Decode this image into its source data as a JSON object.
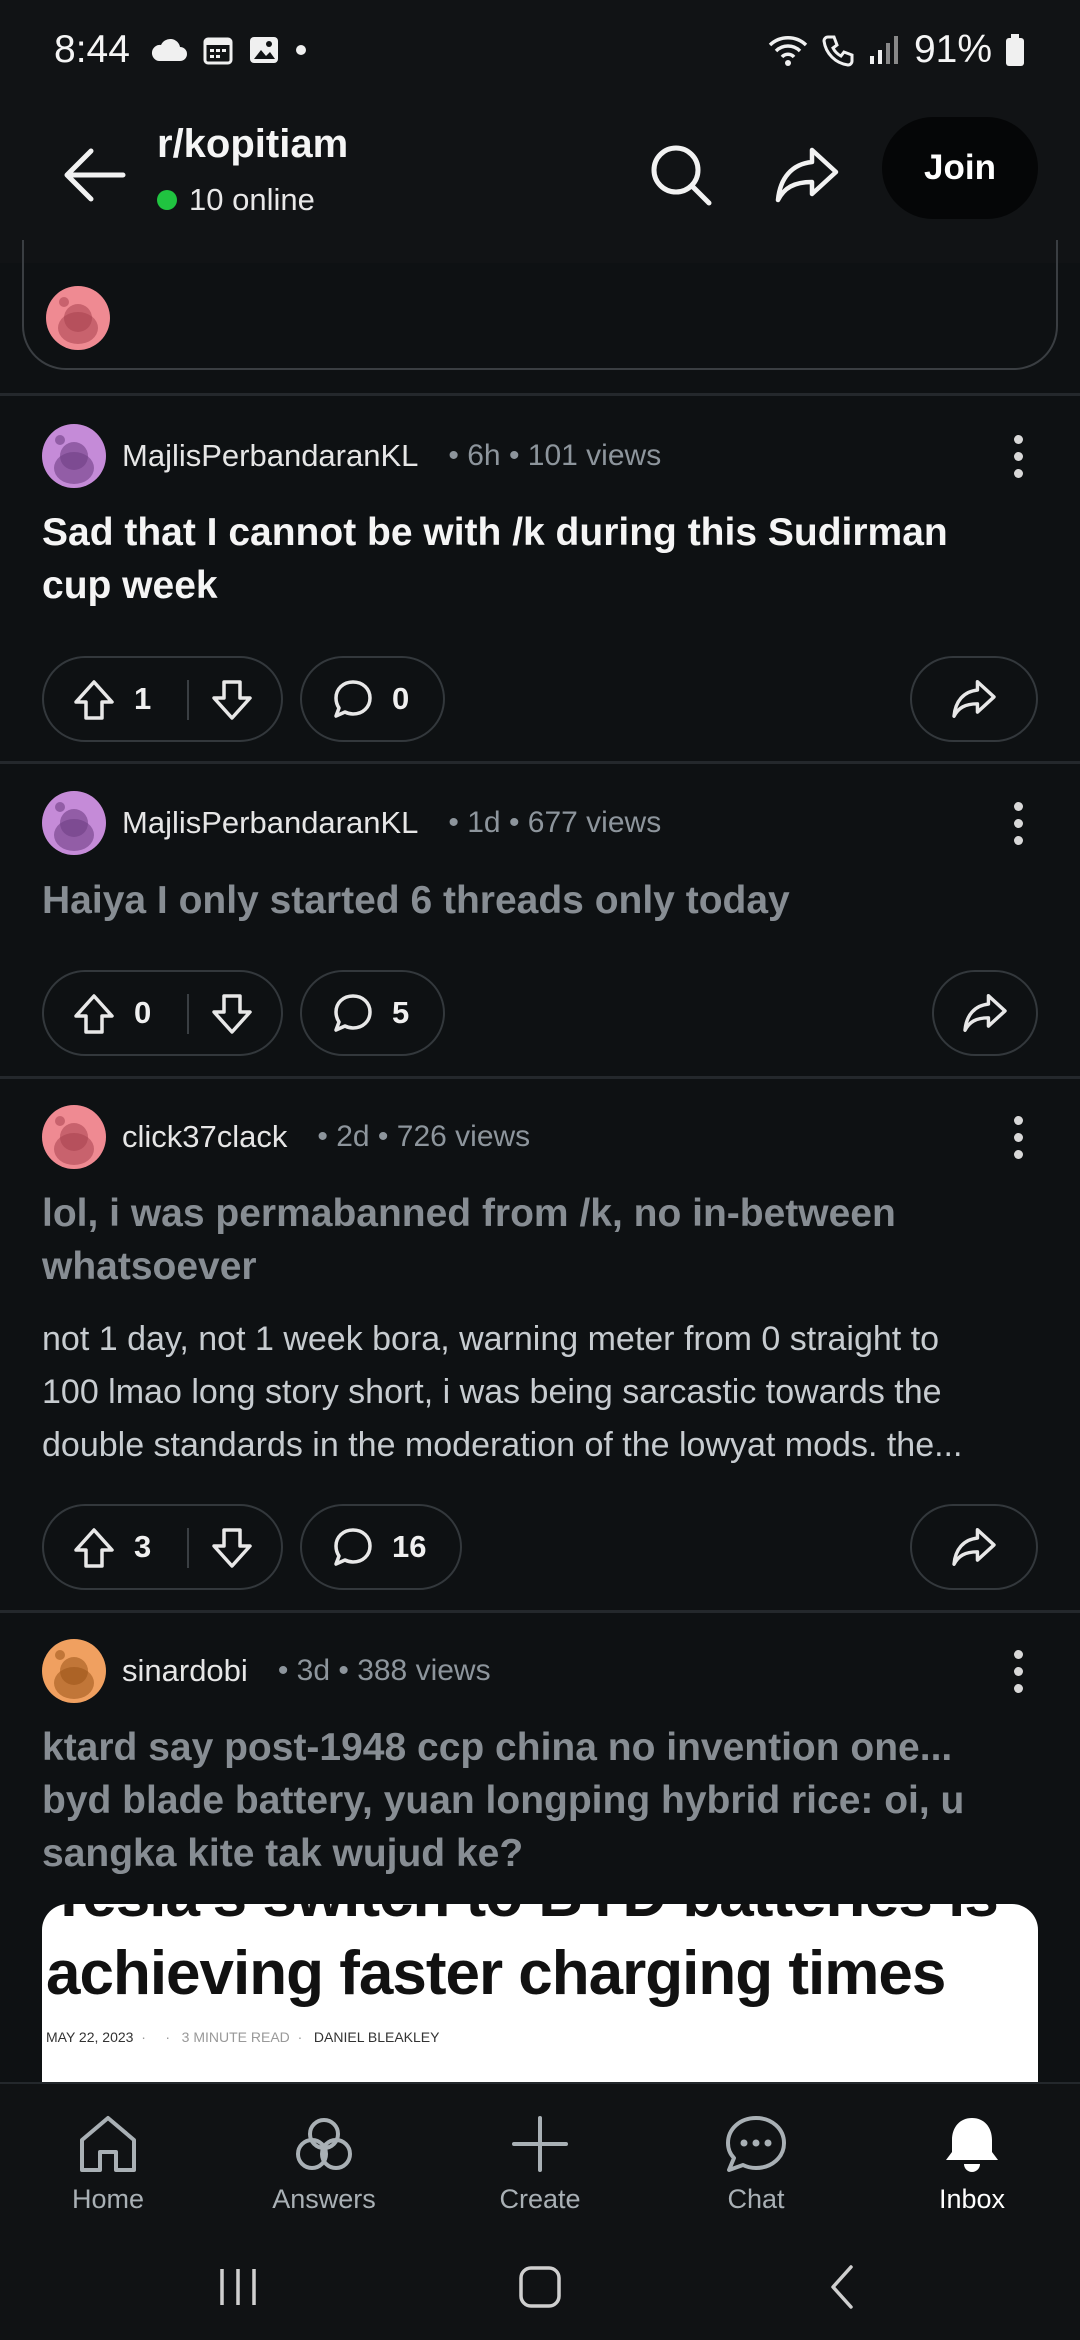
{
  "status_bar": {
    "time": "8:44",
    "battery": "91%"
  },
  "header": {
    "subreddit": "r/kopitiam",
    "online": "10 online",
    "join_label": "Join",
    "colors": {
      "online_dot": "#20c440"
    }
  },
  "posts": [
    {
      "username": "MajlisPerbandaranKL",
      "meta": "• 6h • 101 views",
      "title_line1": "Sad that I cannot be with /k during this Sudirman",
      "title_line2": "cup week",
      "upvotes": "1",
      "comments": "0",
      "avatar_color": "#c58bd8",
      "read": false
    },
    {
      "username": "MajlisPerbandaranKL",
      "meta": "• 1d • 677 views",
      "title_line1": "Haiya I only started 6 threads only today",
      "upvotes": "0",
      "comments": "5",
      "avatar_color": "#c58bd8",
      "read": true
    },
    {
      "username": "click37clack",
      "meta": "• 2d • 726 views",
      "title_line1": "lol, i was permabanned from /k, no in-between",
      "title_line2": "whatsoever",
      "body_line1": "not 1 day, not 1 week bora, warning meter from 0 straight to",
      "body_line2": "100 lmao long story short, i was being sarcastic towards the",
      "body_line3": "double standards in the moderation of the lowyat mods. the...",
      "upvotes": "3",
      "comments": "16",
      "avatar_color": "#ef8a92",
      "read": true
    },
    {
      "username": "sinardobi",
      "meta": "• 3d • 388 views",
      "title_line1": "ktard say post-1948 ccp china no invention one...",
      "title_line2": "byd blade battery, yuan longping hybrid rice: oi, u",
      "title_line3": "sangka kite tak wujud ke?",
      "avatar_color": "#f0a060",
      "read": true,
      "preview": {
        "headline_top_cut": "Tesla's switch to BYD batteries is",
        "headline": "achieving faster charging times",
        "date": "MAY 22, 2023",
        "read_time": "3 MINUTE READ",
        "author": "DANIEL BLEAKLEY"
      }
    }
  ],
  "bottom_nav": {
    "items": [
      {
        "label": "Home",
        "icon": "home-icon"
      },
      {
        "label": "Answers",
        "icon": "answers-icon"
      },
      {
        "label": "Create",
        "icon": "plus-icon"
      },
      {
        "label": "Chat",
        "icon": "chat-icon"
      },
      {
        "label": "Inbox",
        "icon": "bell-icon",
        "active": true
      }
    ]
  }
}
